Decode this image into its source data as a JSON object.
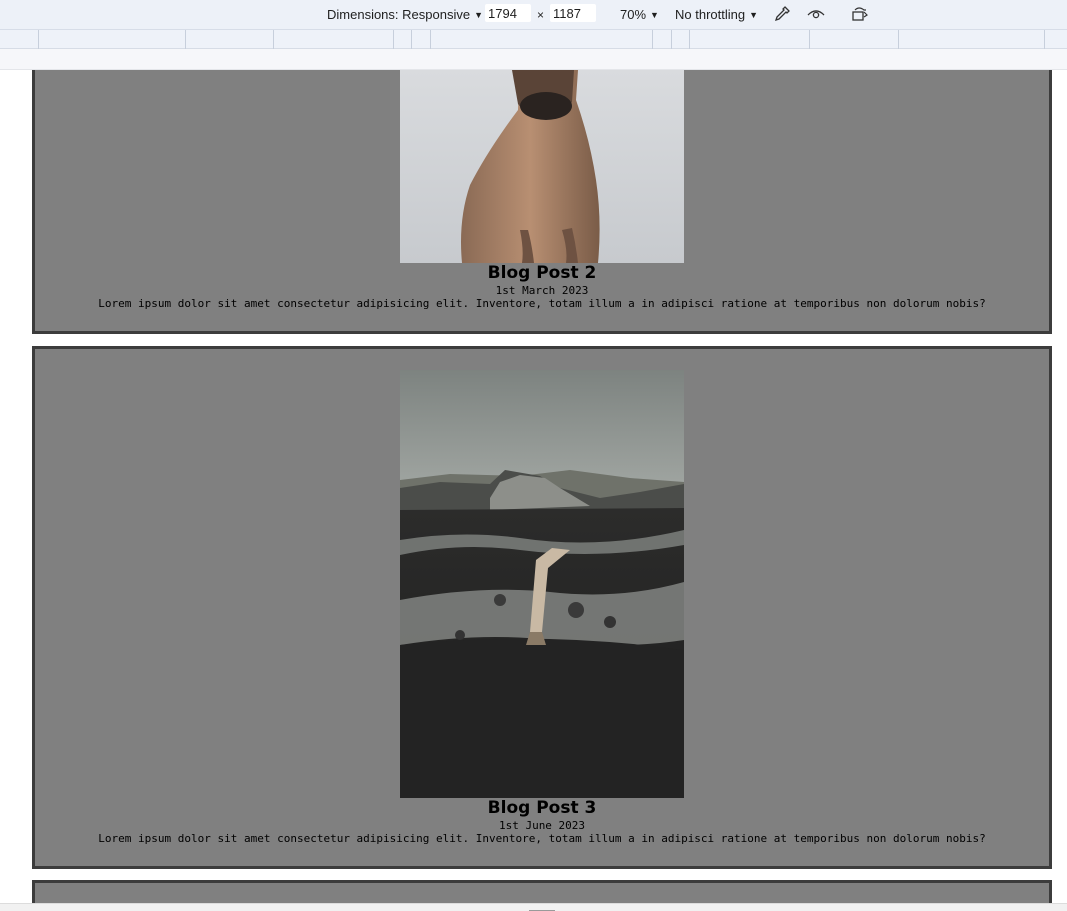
{
  "devtools": {
    "dimensions_label": "Dimensions: Responsive",
    "width_value": "1794",
    "times": "×",
    "height_value": "1187",
    "zoom": "70%",
    "throttling": "No throttling",
    "icons": [
      "eyedropper-icon",
      "eye-icon",
      "rotate-icon"
    ]
  },
  "posts": [
    {
      "title": "Blog Post 2",
      "date": "1st March 2023",
      "body": "Lorem ipsum dolor sit amet consectetur adipisicing elit. Inventore, totam illum a in adipisci ratione at temporibus non dolorum nobis?",
      "image": "horse-photo"
    },
    {
      "title": "Blog Post 3",
      "date": "1st June 2023",
      "body": "Lorem ipsum dolor sit amet consectetur adipisicing elit. Inventore, totam illum a in adipisci ratione at temporibus non dolorum nobis?",
      "image": "mountain-bridge-photo"
    }
  ],
  "colors": {
    "card_background": "#808080",
    "card_border": "#3c3c3c",
    "toolbar_background": "#edf1f8"
  }
}
